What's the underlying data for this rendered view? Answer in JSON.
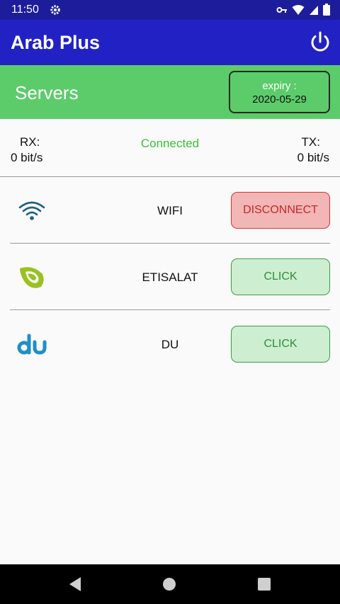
{
  "status_bar": {
    "time": "11:50"
  },
  "app": {
    "title": "Arab Plus"
  },
  "servers": {
    "title": "Servers",
    "expiry_label": "expiry :",
    "expiry_date": "2020-05-29"
  },
  "stats": {
    "rx_label": "RX:",
    "rx_value": "0 bit/s",
    "tx_label": "TX:",
    "tx_value": "0 bit/s",
    "status": "Connected"
  },
  "rows": [
    {
      "icon": "wifi-icon",
      "label": "WIFI",
      "button": "DISCONNECT"
    },
    {
      "icon": "etisalat-logo",
      "label": "ETISALAT",
      "button": "CLICK"
    },
    {
      "icon": "du-logo",
      "label": "DU",
      "button": "CLICK"
    }
  ],
  "colors": {
    "app_bar": "#2222c4",
    "servers_bar": "#5ccc6a",
    "connected": "#3dbf35",
    "disconnect": "#c62828",
    "click": "#2f8d3a"
  }
}
